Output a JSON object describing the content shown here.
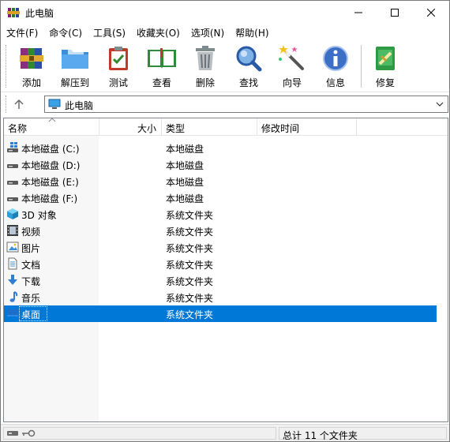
{
  "window": {
    "title": "此电脑"
  },
  "menu": [
    {
      "label": "文件(F)"
    },
    {
      "label": "命令(C)"
    },
    {
      "label": "工具(S)"
    },
    {
      "label": "收藏夹(O)"
    },
    {
      "label": "选项(N)"
    },
    {
      "label": "帮助(H)"
    }
  ],
  "toolbar": {
    "add": "添加",
    "extract": "解压到",
    "test": "测试",
    "view": "查看",
    "delete": "删除",
    "find": "查找",
    "wizard": "向导",
    "info": "信息",
    "repair": "修复"
  },
  "address": {
    "path": "此电脑"
  },
  "columns": {
    "name": "名称",
    "size": "大小",
    "type": "类型",
    "modified": "修改时间"
  },
  "rows": [
    {
      "name": "本地磁盘 (C:)",
      "type": "本地磁盘",
      "icon": "drive-system-icon"
    },
    {
      "name": "本地磁盘 (D:)",
      "type": "本地磁盘",
      "icon": "drive-icon"
    },
    {
      "name": "本地磁盘 (E:)",
      "type": "本地磁盘",
      "icon": "drive-icon"
    },
    {
      "name": "本地磁盘 (F:)",
      "type": "本地磁盘",
      "icon": "drive-icon"
    },
    {
      "name": "3D 对象",
      "type": "系统文件夹",
      "icon": "3d-objects-icon"
    },
    {
      "name": "视频",
      "type": "系统文件夹",
      "icon": "video-icon"
    },
    {
      "name": "图片",
      "type": "系统文件夹",
      "icon": "pictures-icon"
    },
    {
      "name": "文档",
      "type": "系统文件夹",
      "icon": "documents-icon"
    },
    {
      "name": "下载",
      "type": "系统文件夹",
      "icon": "downloads-icon"
    },
    {
      "name": "音乐",
      "type": "系统文件夹",
      "icon": "music-icon"
    },
    {
      "name": "桌面",
      "type": "系统文件夹",
      "icon": "desktop-icon"
    }
  ],
  "selected_row": 10,
  "status": {
    "summary": "总计 11 个文件夹"
  },
  "colors": {
    "selection": "#0078d7"
  }
}
